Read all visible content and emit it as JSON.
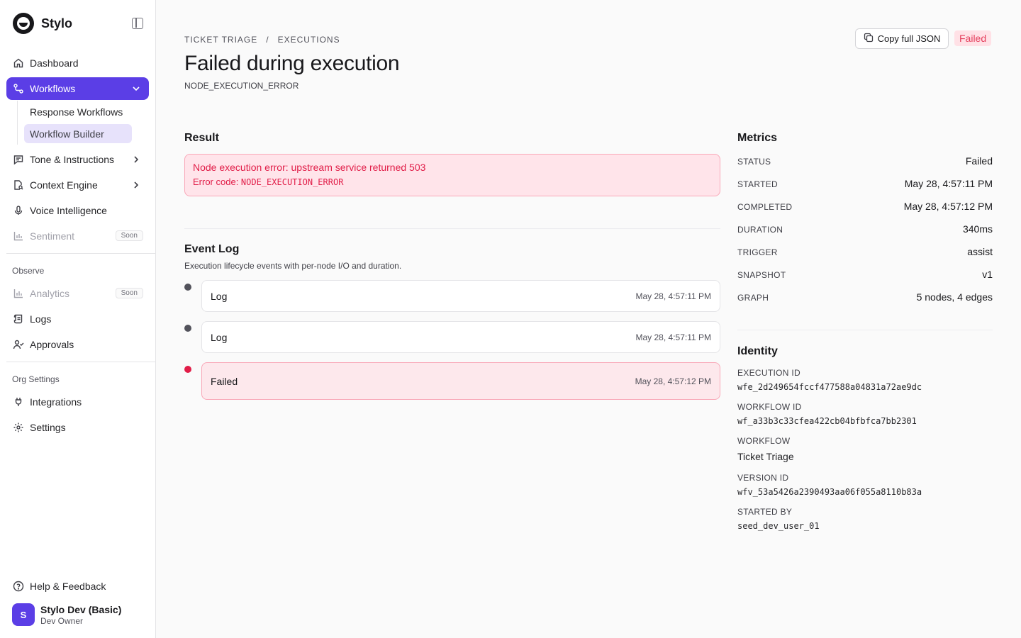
{
  "brand": {
    "name": "Stylo"
  },
  "sidebar": {
    "items": [
      {
        "label": "Dashboard"
      },
      {
        "label": "Workflows"
      },
      {
        "label": "Response Workflows"
      },
      {
        "label": "Workflow Builder"
      },
      {
        "label": "Tone & Instructions"
      },
      {
        "label": "Context Engine"
      },
      {
        "label": "Voice Intelligence"
      },
      {
        "label": "Sentiment",
        "badge": "Soon"
      }
    ],
    "observe_label": "Observe",
    "observe_items": [
      {
        "label": "Analytics",
        "badge": "Soon"
      },
      {
        "label": "Logs"
      },
      {
        "label": "Approvals"
      }
    ],
    "org_label": "Org Settings",
    "org_items": [
      {
        "label": "Integrations"
      },
      {
        "label": "Settings"
      }
    ],
    "help_label": "Help & Feedback",
    "user": {
      "initial": "S",
      "name": "Stylo Dev (Basic)",
      "role": "Dev Owner"
    }
  },
  "header": {
    "breadcrumb": [
      "TICKET TRIAGE",
      "/",
      "EXECUTIONS"
    ],
    "title": "Failed during execution",
    "subtitle": "NODE_EXECUTION_ERROR",
    "copy_label": "Copy full JSON",
    "status": "Failed"
  },
  "result": {
    "heading": "Result",
    "message": "Node execution error: upstream service returned 503",
    "code_prefix": "Error code: ",
    "code": "NODE_EXECUTION_ERROR"
  },
  "event_log": {
    "heading": "Event Log",
    "description": "Execution lifecycle events with per-node I/O and duration.",
    "events": [
      {
        "name": "Log",
        "time": "May 28, 4:57:11 PM"
      },
      {
        "name": "Log",
        "time": "May 28, 4:57:11 PM"
      },
      {
        "name": "Failed",
        "time": "May 28, 4:57:12 PM"
      }
    ]
  },
  "metrics": {
    "heading": "Metrics",
    "rows": [
      {
        "key": "STATUS",
        "value": "Failed"
      },
      {
        "key": "STARTED",
        "value": "May 28, 4:57:11 PM"
      },
      {
        "key": "COMPLETED",
        "value": "May 28, 4:57:12 PM"
      },
      {
        "key": "DURATION",
        "value": "340ms"
      },
      {
        "key": "TRIGGER",
        "value": "assist"
      },
      {
        "key": "SNAPSHOT",
        "value": "v1"
      },
      {
        "key": "GRAPH",
        "value": "5 nodes, 4 edges"
      }
    ]
  },
  "identity": {
    "heading": "Identity",
    "rows": [
      {
        "key": "EXECUTION ID",
        "value": "wfe_2d249654fccf477588a04831a72ae9dc"
      },
      {
        "key": "WORKFLOW ID",
        "value": "wf_a33b3c33cfea422cb04bfbfca7bb2301"
      },
      {
        "key": "WORKFLOW",
        "value": "Ticket Triage"
      },
      {
        "key": "VERSION ID",
        "value": "wfv_53a5426a2390493aa06f055a8110b83a"
      },
      {
        "key": "STARTED BY",
        "value": "seed_dev_user_01"
      }
    ]
  },
  "colors": {
    "accent": "#5b3ee6",
    "error": "#e11d48",
    "error_bg": "#ffe4ea"
  }
}
